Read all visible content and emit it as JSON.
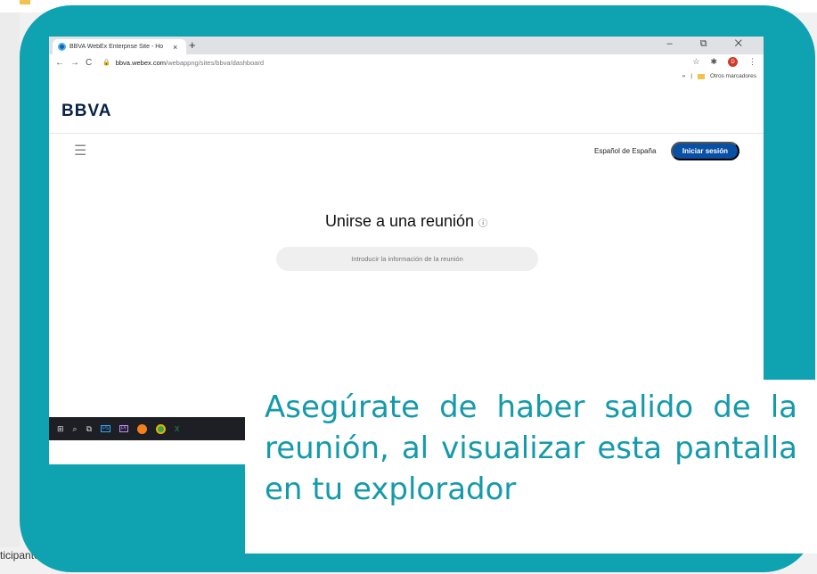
{
  "background": {
    "bottom_text": "ticipantes"
  },
  "browser": {
    "tab_title": "BBVA WebEx Enterprise Site - Ho",
    "tab_close": "×",
    "new_tab": "+",
    "window_controls": "– ⧉ ✕",
    "nav_back": "←",
    "nav_forward": "→",
    "nav_reload": "C",
    "url_host": "bbva.webex.com",
    "url_path": "/webappng/sites/bbva/dashboard",
    "bookmarks_more": "»",
    "bookmarks_folder": "Otros marcadores",
    "profile_initial": "D"
  },
  "site": {
    "logo": "BBVA",
    "language": "Español de España",
    "signin_label": "Iniciar sesión",
    "join_title": "Unirse a una reunión",
    "join_info_icon": "ⓘ",
    "join_placeholder": "Introducir la información de la reunión"
  },
  "taskbar": {
    "items": [
      "start-icon",
      "search-icon",
      "task-view-icon",
      "photoshop-icon",
      "premiere-icon",
      "firefox-icon",
      "chrome-icon",
      "excel-icon"
    ],
    "ps": "Ps",
    "pr": "Pr",
    "xl": "X"
  },
  "note": {
    "text": "Asegúrate de haber salido de la reunión, al visualizar esta pantalla en tu explorador"
  },
  "colors": {
    "teal": "#0fa3b1",
    "note_text": "#149aaa",
    "bbva_blue": "#072146",
    "signin_blue": "#094fa3"
  }
}
